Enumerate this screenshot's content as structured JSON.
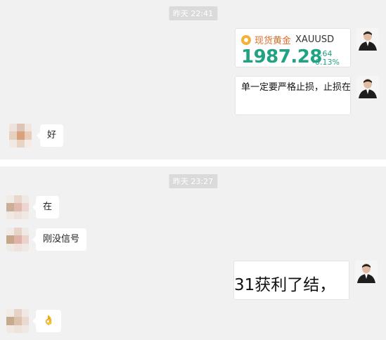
{
  "chat": {
    "timestamps": [
      "昨天 22:41",
      "昨天 23:27"
    ],
    "quote_card": {
      "name": "现货黄金",
      "symbol": "XAUUSD",
      "price": "1987.28",
      "change": "-2.64",
      "change_pct": "-0.13%",
      "accent_color": "#21a383",
      "icon": "gold-coin-icon"
    },
    "messages": [
      {
        "side": "right",
        "text": "单一定要严格止损，止损在"
      },
      {
        "side": "left",
        "text": "好"
      },
      {
        "side": "left",
        "text": "在"
      },
      {
        "side": "left",
        "text": "刚没信号"
      },
      {
        "side": "right",
        "text": "31获利了结，"
      },
      {
        "side": "left",
        "text": "👌"
      }
    ]
  }
}
